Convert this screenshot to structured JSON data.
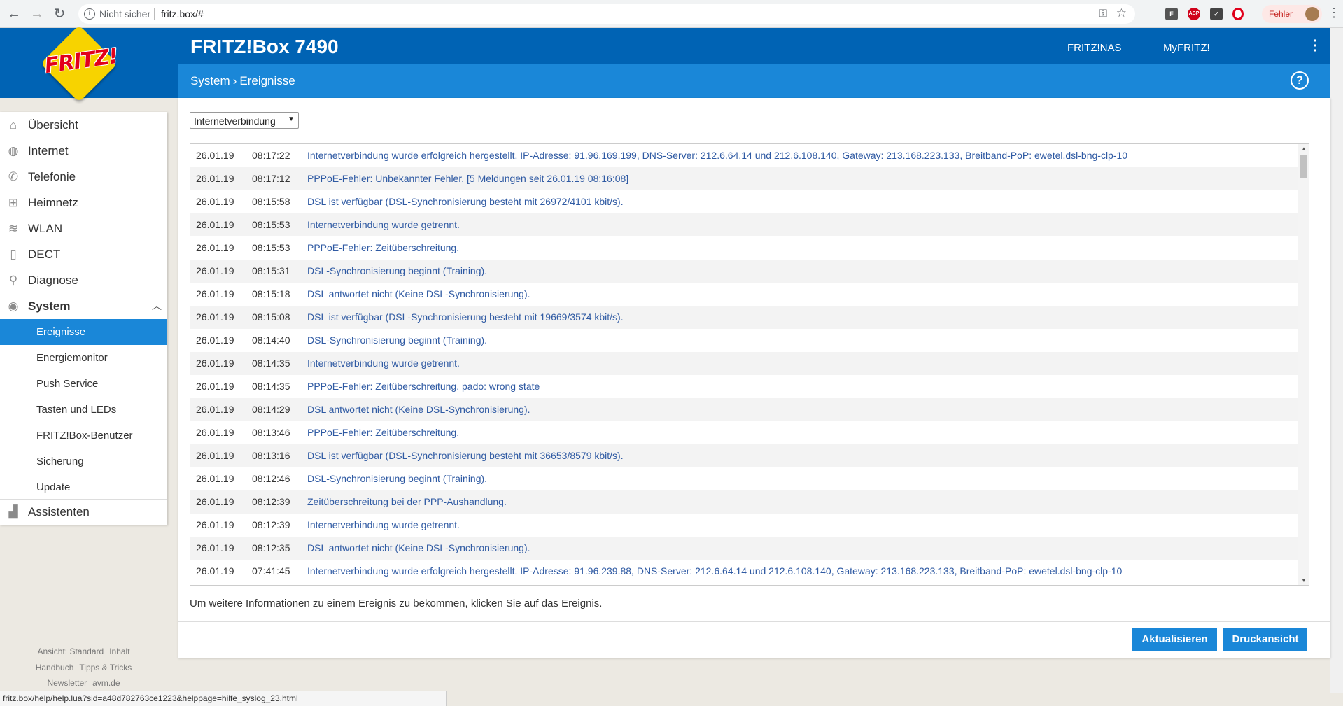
{
  "browser": {
    "security_label": "Nicht sicher",
    "url": "fritz.box/#",
    "profile_label": "Fehler",
    "status_url": "fritz.box/help/help.lua?sid=a48d782763ce1223&helppage=hilfe_syslog_23.html"
  },
  "header": {
    "logo": "FRITZ!",
    "title": "FRITZ!Box 7490",
    "links": [
      "FRITZ!NAS",
      "MyFRITZ!"
    ],
    "breadcrumb": [
      "System",
      "Ereignisse"
    ],
    "help": "?"
  },
  "sidebar": {
    "items": [
      {
        "label": "Übersicht",
        "icon": "home-icon"
      },
      {
        "label": "Internet",
        "icon": "globe-icon"
      },
      {
        "label": "Telefonie",
        "icon": "phone-icon"
      },
      {
        "label": "Heimnetz",
        "icon": "network-icon"
      },
      {
        "label": "WLAN",
        "icon": "wifi-icon"
      },
      {
        "label": "DECT",
        "icon": "dect-icon"
      },
      {
        "label": "Diagnose",
        "icon": "diagnose-icon"
      },
      {
        "label": "System",
        "icon": "system-icon"
      }
    ],
    "system_sub": [
      "Ereignisse",
      "Energiemonitor",
      "Push Service",
      "Tasten und LEDs",
      "FRITZ!Box-Benutzer",
      "Sicherung",
      "Update"
    ],
    "assistant": {
      "label": "Assistenten",
      "icon": "assistant-icon"
    }
  },
  "footer": {
    "row1": [
      "Ansicht: Standard",
      "Inhalt"
    ],
    "row2": [
      "Handbuch",
      "Tipps & Tricks"
    ],
    "row3": [
      "Newsletter",
      "avm.de"
    ]
  },
  "main": {
    "filter_value": "Internetverbindung",
    "log": [
      {
        "date": "26.01.19",
        "time": "08:17:22",
        "msg": "Internetverbindung wurde erfolgreich hergestellt. IP-Adresse: 91.96.169.199, DNS-Server: 212.6.64.14 und 212.6.108.140, Gateway: 213.168.223.133, Breitband-PoP: ewetel.dsl-bng-clp-10"
      },
      {
        "date": "26.01.19",
        "time": "08:17:12",
        "msg": "PPPoE-Fehler: Unbekannter Fehler. [5 Meldungen seit 26.01.19 08:16:08]"
      },
      {
        "date": "26.01.19",
        "time": "08:15:58",
        "msg": "DSL ist verfügbar (DSL-Synchronisierung besteht mit 26972/4101 kbit/s)."
      },
      {
        "date": "26.01.19",
        "time": "08:15:53",
        "msg": "Internetverbindung wurde getrennt."
      },
      {
        "date": "26.01.19",
        "time": "08:15:53",
        "msg": "PPPoE-Fehler: Zeitüberschreitung."
      },
      {
        "date": "26.01.19",
        "time": "08:15:31",
        "msg": "DSL-Synchronisierung beginnt (Training)."
      },
      {
        "date": "26.01.19",
        "time": "08:15:18",
        "msg": "DSL antwortet nicht (Keine DSL-Synchronisierung)."
      },
      {
        "date": "26.01.19",
        "time": "08:15:08",
        "msg": "DSL ist verfügbar (DSL-Synchronisierung besteht mit 19669/3574 kbit/s)."
      },
      {
        "date": "26.01.19",
        "time": "08:14:40",
        "msg": "DSL-Synchronisierung beginnt (Training)."
      },
      {
        "date": "26.01.19",
        "time": "08:14:35",
        "msg": "Internetverbindung wurde getrennt."
      },
      {
        "date": "26.01.19",
        "time": "08:14:35",
        "msg": "PPPoE-Fehler: Zeitüberschreitung. pado: wrong state"
      },
      {
        "date": "26.01.19",
        "time": "08:14:29",
        "msg": "DSL antwortet nicht (Keine DSL-Synchronisierung)."
      },
      {
        "date": "26.01.19",
        "time": "08:13:46",
        "msg": "PPPoE-Fehler: Zeitüberschreitung."
      },
      {
        "date": "26.01.19",
        "time": "08:13:16",
        "msg": "DSL ist verfügbar (DSL-Synchronisierung besteht mit 36653/8579 kbit/s)."
      },
      {
        "date": "26.01.19",
        "time": "08:12:46",
        "msg": "DSL-Synchronisierung beginnt (Training)."
      },
      {
        "date": "26.01.19",
        "time": "08:12:39",
        "msg": "Zeitüberschreitung bei der PPP-Aushandlung."
      },
      {
        "date": "26.01.19",
        "time": "08:12:39",
        "msg": "Internetverbindung wurde getrennt."
      },
      {
        "date": "26.01.19",
        "time": "08:12:35",
        "msg": "DSL antwortet nicht (Keine DSL-Synchronisierung)."
      },
      {
        "date": "26.01.19",
        "time": "07:41:45",
        "msg": "Internetverbindung wurde erfolgreich hergestellt. IP-Adresse: 91.96.239.88, DNS-Server: 212.6.64.14 und 212.6.108.140, Gateway: 213.168.223.133, Breitband-PoP: ewetel.dsl-bng-clp-10"
      }
    ],
    "info": "Um weitere Informationen zu einem Ereignis zu bekommen, klicken Sie auf das Ereignis.",
    "refresh_label": "Aktualisieren",
    "print_label": "Druckansicht"
  },
  "colors": {
    "brand_dark": "#0063b4",
    "brand_light": "#1a87d8",
    "link": "#2f5aa3",
    "logo_yellow": "#f7d300",
    "logo_red": "#e2001a"
  }
}
